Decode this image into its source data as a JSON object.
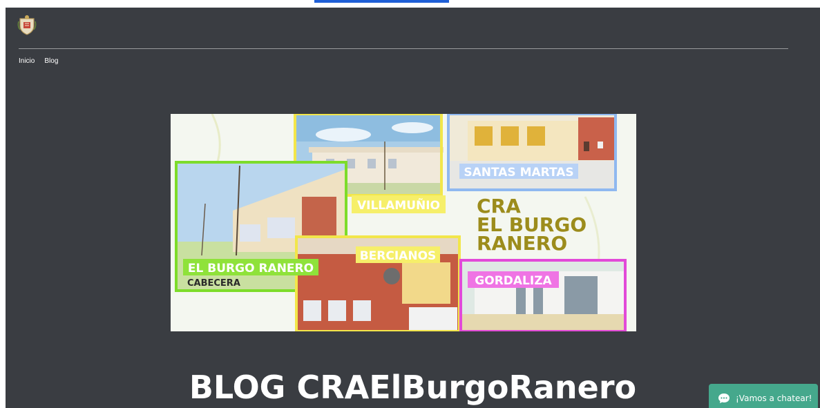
{
  "nav": {
    "items": [
      {
        "label": "Inicio"
      },
      {
        "label": "Blog"
      }
    ]
  },
  "banner": {
    "schools": {
      "santas_martas": "SANTAS MARTAS",
      "villamunio": "VILLAMUÑIO",
      "el_burgo_ranero": "EL BURGO RANERO",
      "cabecera": "CABECERA",
      "bercianos": "BERCIANOS",
      "gordaliza": "GORDALIZA"
    },
    "title_lines": [
      "CRA",
      "EL BURGO",
      "RANERO"
    ]
  },
  "blog_title": "BLOG CRAElBurgoRanero",
  "chat": {
    "label": "¡Vamos a chatear!",
    "icon": "chat-bubble-icon"
  },
  "colors": {
    "page_bg": "#3a3d42",
    "chat_bg": "#45a88c",
    "accent_green": "#7ddc2a",
    "accent_yellow": "#f2e64a",
    "accent_blue": "#8fb8f0",
    "accent_pink": "#e24ad8",
    "title_olive": "#9c8c1c"
  }
}
